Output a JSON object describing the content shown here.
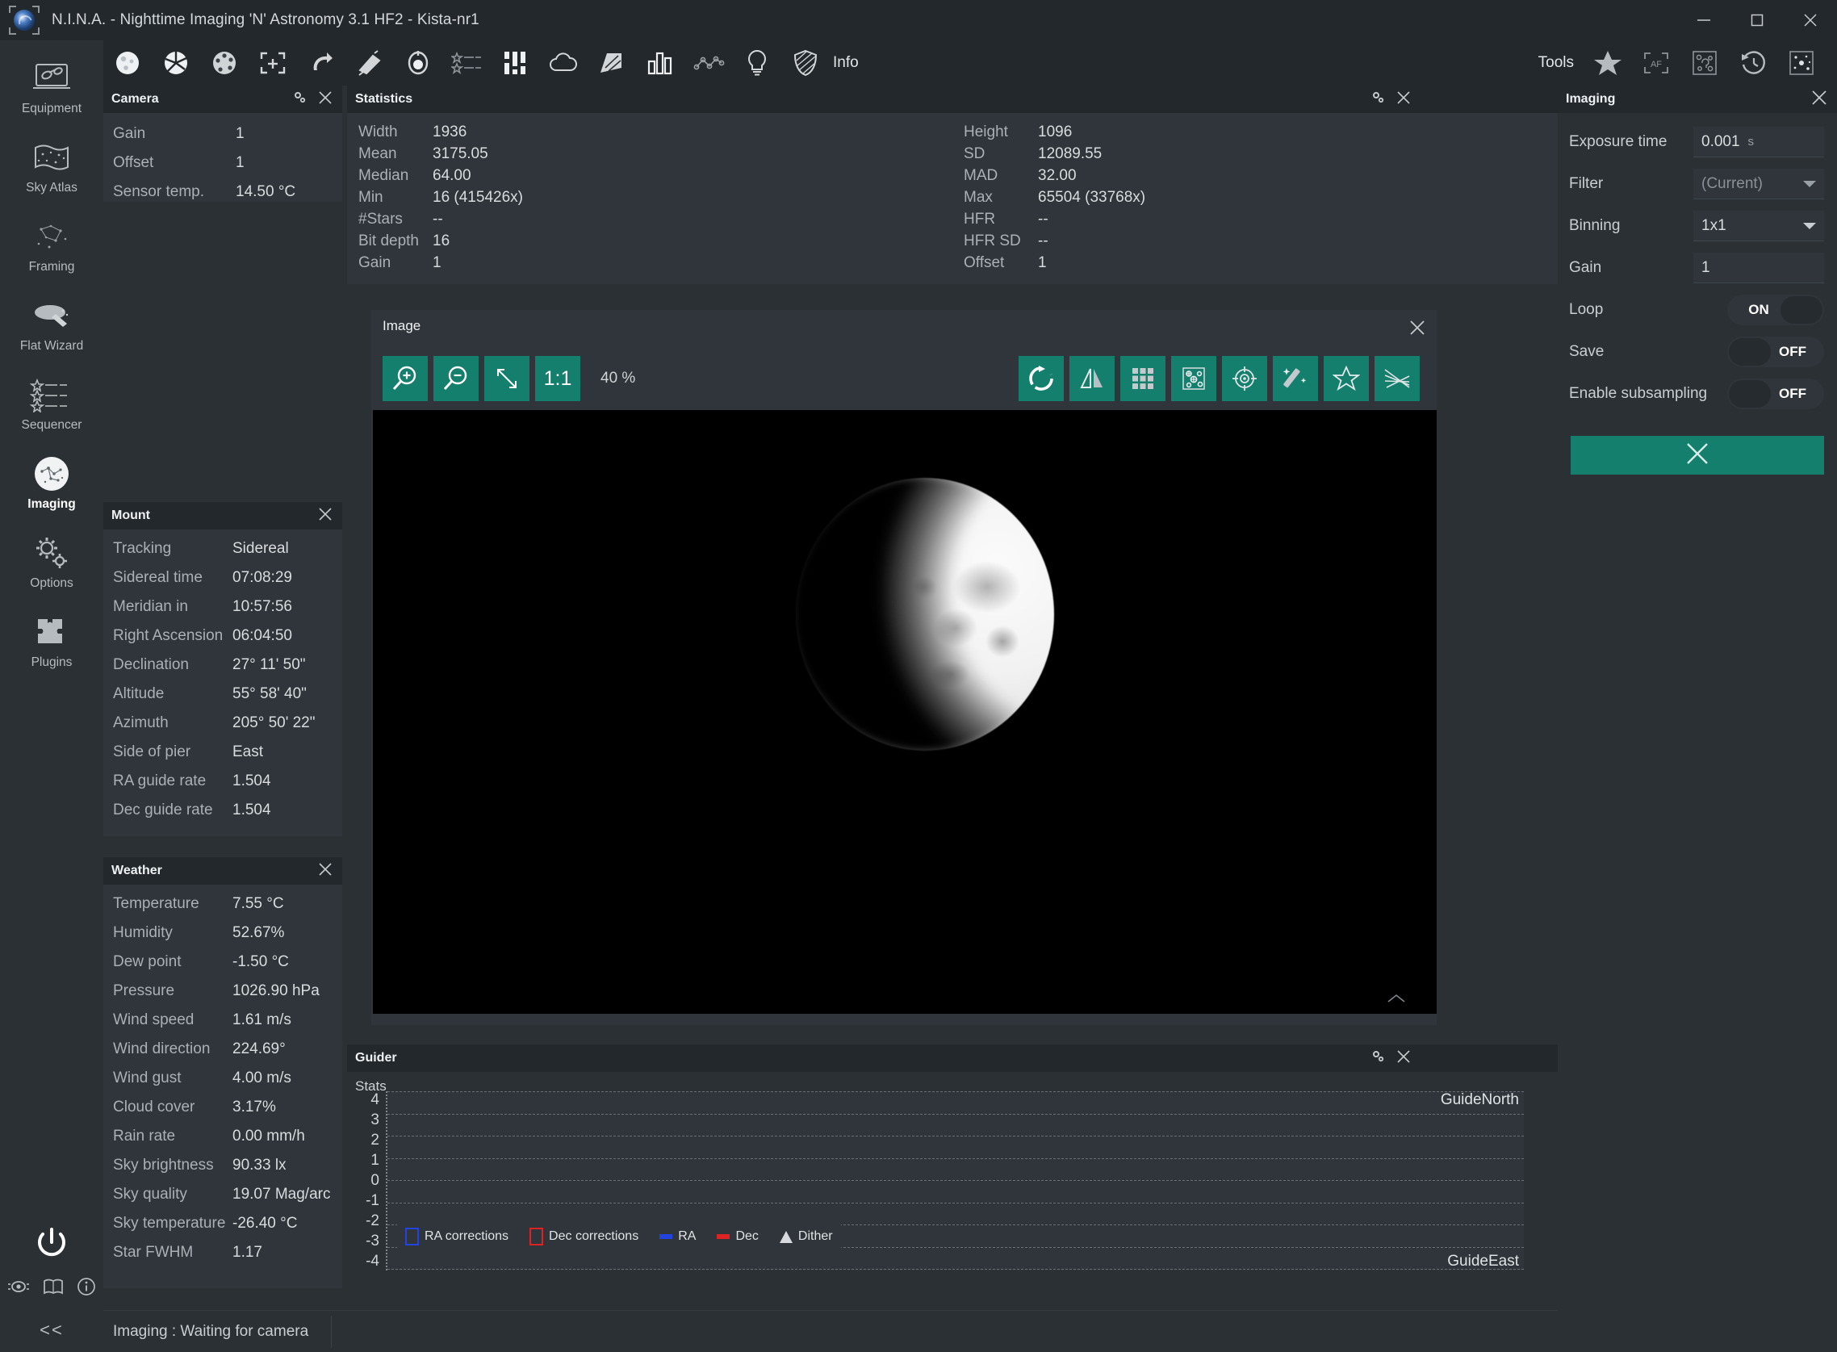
{
  "window": {
    "title": "N.I.N.A. - Nighttime Imaging 'N' Astronomy 3.1 HF2   -  Kista-nr1",
    "logo_icon": "nina-logo-icon",
    "minimize_icon": "minimize-icon",
    "maximize_icon": "maximize-icon",
    "close_icon": "close-icon"
  },
  "rail": {
    "items": [
      {
        "label": "Equipment",
        "icon": "equipment-icon",
        "active": false
      },
      {
        "label": "Sky Atlas",
        "icon": "sky-atlas-icon",
        "active": false
      },
      {
        "label": "Framing",
        "icon": "framing-icon",
        "active": false
      },
      {
        "label": "Flat Wizard",
        "icon": "flat-wizard-icon",
        "active": false
      },
      {
        "label": "Sequencer",
        "icon": "sequencer-icon",
        "active": false
      },
      {
        "label": "Imaging",
        "icon": "imaging-icon",
        "active": true
      },
      {
        "label": "Options",
        "icon": "options-gear-icon",
        "active": false
      },
      {
        "label": "Plugins",
        "icon": "plugins-puzzle-icon",
        "active": false
      }
    ],
    "power_icon": "power-icon",
    "mini_icons": [
      "eye-icon",
      "manual-book-icon",
      "info-circle-icon"
    ],
    "collapse_label": "<<"
  },
  "toolbar": {
    "items": [
      {
        "icon": "moon-icon"
      },
      {
        "icon": "aperture-icon"
      },
      {
        "icon": "filter-wheel-icon"
      },
      {
        "icon": "focus-frame-icon"
      },
      {
        "icon": "rotator-icon"
      },
      {
        "icon": "telescope-icon"
      },
      {
        "icon": "guider-target-icon"
      },
      {
        "icon": "sequence-list-icon"
      },
      {
        "icon": "switch-sliders-icon"
      },
      {
        "icon": "cloud-icon"
      },
      {
        "icon": "flat-panel-icon"
      },
      {
        "icon": "histogram-chart-icon"
      },
      {
        "icon": "hfr-graph-icon"
      },
      {
        "icon": "lightbulb-icon"
      },
      {
        "icon": "shield-icon"
      }
    ],
    "info_label": "Info",
    "tools_label": "Tools",
    "tools_items": [
      {
        "icon": "star-filled-icon"
      },
      {
        "icon": "autofocus-af-icon"
      },
      {
        "icon": "plate-solve-icon"
      },
      {
        "icon": "history-clock-icon"
      },
      {
        "icon": "star-field-icon"
      }
    ]
  },
  "camera": {
    "title": "Camera",
    "gear_icon": "gear-icon",
    "close_icon": "close-icon",
    "rows": [
      {
        "key": "Gain",
        "value": "1"
      },
      {
        "key": "Offset",
        "value": "1"
      },
      {
        "key": "Sensor temp.",
        "value": "14.50 °C"
      }
    ]
  },
  "statistics": {
    "title": "Statistics",
    "gear_icon": "gear-icon",
    "close_icon": "close-icon",
    "left_rows": [
      {
        "key": "Width",
        "value": "1936"
      },
      {
        "key": "Mean",
        "value": "3175.05"
      },
      {
        "key": "Median",
        "value": "64.00"
      },
      {
        "key": "Min",
        "value": "16 (415426x)"
      },
      {
        "key": "#Stars",
        "value": "--"
      },
      {
        "key": "Bit depth",
        "value": "16"
      },
      {
        "key": "Gain",
        "value": "1"
      }
    ],
    "right_rows": [
      {
        "key": "Height",
        "value": "1096"
      },
      {
        "key": "SD",
        "value": "12089.55"
      },
      {
        "key": "MAD",
        "value": "32.00"
      },
      {
        "key": "Max",
        "value": "65504 (33768x)"
      },
      {
        "key": "HFR",
        "value": "--"
      },
      {
        "key": "HFR SD",
        "value": "--"
      },
      {
        "key": "Offset",
        "value": "1"
      }
    ]
  },
  "mount": {
    "title": "Mount",
    "close_icon": "close-icon",
    "rows": [
      {
        "key": "Tracking",
        "value": "Sidereal"
      },
      {
        "key": "Sidereal time",
        "value": "07:08:29"
      },
      {
        "key": "Meridian in",
        "value": "10:57:56"
      },
      {
        "key": "Right Ascension",
        "value": "06:04:50"
      },
      {
        "key": "Declination",
        "value": "27° 11' 50\""
      },
      {
        "key": "Altitude",
        "value": "55° 58' 40\""
      },
      {
        "key": "Azimuth",
        "value": "205° 50' 22\""
      },
      {
        "key": "Side of pier",
        "value": "East"
      },
      {
        "key": "RA guide rate",
        "value": "1.504"
      },
      {
        "key": "Dec guide rate",
        "value": "1.504"
      }
    ]
  },
  "weather": {
    "title": "Weather",
    "close_icon": "close-icon",
    "rows": [
      {
        "key": "Temperature",
        "value": "7.55 °C"
      },
      {
        "key": "Humidity",
        "value": "52.67%"
      },
      {
        "key": "Dew point",
        "value": "-1.50 °C"
      },
      {
        "key": "Pressure",
        "value": "1026.90 hPa"
      },
      {
        "key": "Wind speed",
        "value": "1.61 m/s"
      },
      {
        "key": "Wind direction",
        "value": "224.69°"
      },
      {
        "key": "Wind gust",
        "value": "4.00 m/s"
      },
      {
        "key": "Cloud cover",
        "value": "3.17%"
      },
      {
        "key": "Rain rate",
        "value": "0.00 mm/h"
      },
      {
        "key": "Sky brightness",
        "value": "90.33 lx"
      },
      {
        "key": "Sky quality",
        "value": "19.07 Mag/arc"
      },
      {
        "key": "Sky temperature",
        "value": "-26.40 °C"
      },
      {
        "key": "Star FWHM",
        "value": "1.17"
      }
    ]
  },
  "image": {
    "title": "Image",
    "close_icon": "close-icon",
    "zoom_percent": "40 %",
    "left_buttons": [
      {
        "icon": "zoom-in-icon",
        "label": ""
      },
      {
        "icon": "zoom-out-icon",
        "label": ""
      },
      {
        "icon": "fit-to-screen-icon",
        "label": ""
      },
      {
        "icon": "zoom-one-to-one-icon",
        "label": "1:1"
      }
    ],
    "right_buttons": [
      {
        "icon": "rotate-icon"
      },
      {
        "icon": "flip-horizontal-icon"
      },
      {
        "icon": "grid-icon"
      },
      {
        "icon": "star-detection-icon"
      },
      {
        "icon": "crosshair-target-icon"
      },
      {
        "icon": "auto-stretch-wand-icon"
      },
      {
        "icon": "star-annotation-icon"
      },
      {
        "icon": "bahtinov-analysis-icon"
      }
    ],
    "preview_subject": "moon-waxing-gibbous"
  },
  "guider": {
    "title": "Guider",
    "subtitle": "Stats",
    "gear_icon": "gear-icon",
    "close_icon": "close-icon",
    "north_label": "GuideNorth",
    "east_label": "GuideEast"
  },
  "imaging_panel": {
    "title": "Imaging",
    "close_icon": "close-icon",
    "rows": [
      {
        "key": "Exposure time",
        "type": "text",
        "value": "0.001",
        "unit": "s"
      },
      {
        "key": "Filter",
        "type": "select",
        "value": "(Current)",
        "muted": true
      },
      {
        "key": "Binning",
        "type": "select",
        "value": "1x1",
        "muted": false
      },
      {
        "key": "Gain",
        "type": "text",
        "value": "1",
        "unit": ""
      },
      {
        "key": "Loop",
        "type": "toggle",
        "value": "ON",
        "state": "on"
      },
      {
        "key": "Save",
        "type": "toggle",
        "value": "OFF",
        "state": "off"
      },
      {
        "key": "Enable subsampling",
        "type": "toggle",
        "value": "OFF",
        "state": "off"
      }
    ],
    "action_icon": "cancel-x-icon"
  },
  "statusbar": {
    "text": "Imaging :   Waiting for camera"
  },
  "chart_data": {
    "type": "line",
    "title": "Guider graph",
    "series": [
      {
        "name": "RA corrections",
        "values": [],
        "color": "#2244dd",
        "marker": "square-outline"
      },
      {
        "name": "Dec corrections",
        "values": [],
        "color": "#dd2222",
        "marker": "square-outline"
      },
      {
        "name": "RA",
        "values": [],
        "color": "#2244dd",
        "marker": "dash"
      },
      {
        "name": "Dec",
        "values": [],
        "color": "#dd2222",
        "marker": "dash"
      },
      {
        "name": "Dither",
        "values": [],
        "color": "#d6dadd",
        "marker": "triangle"
      }
    ],
    "x": [],
    "ylabel": "",
    "xlabel": "",
    "ytick_labels": [
      "4",
      "3",
      "2",
      "1",
      "0",
      "-1",
      "-2",
      "-3",
      "-4"
    ],
    "ylim": [
      -4,
      4
    ],
    "grid": true,
    "legend_position": "bottom-left",
    "annotations": [
      "GuideNorth",
      "GuideEast"
    ]
  },
  "colors": {
    "accent": "#157f6e",
    "window_bg": "#2b3034",
    "panel_bg": "#2f353a",
    "header_bg": "#23282c",
    "text": "#c8cdd1",
    "ra_blue": "#2244dd",
    "dec_red": "#dd2222"
  }
}
